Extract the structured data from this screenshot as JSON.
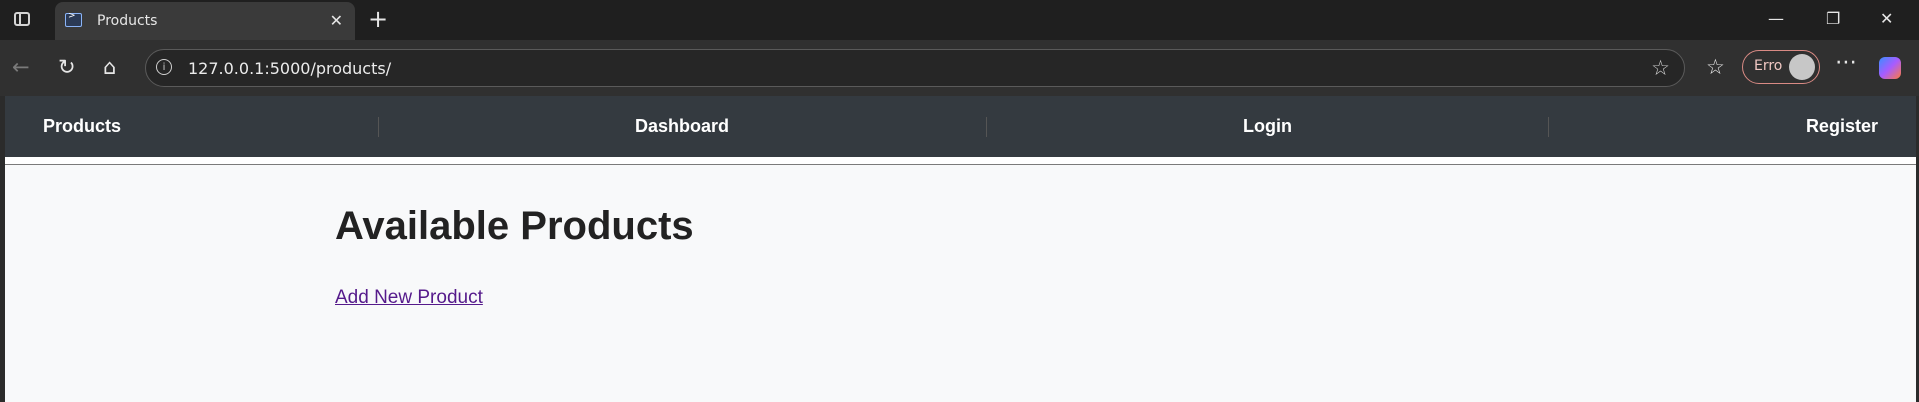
{
  "browser": {
    "tab_title": "Products",
    "url": "127.0.0.1:5000/products/",
    "profile_label": "Erro"
  },
  "nav": {
    "items": [
      "Products",
      "Dashboard",
      "Login",
      "Register"
    ]
  },
  "main": {
    "heading": "Available Products",
    "add_link": "Add New Product"
  }
}
